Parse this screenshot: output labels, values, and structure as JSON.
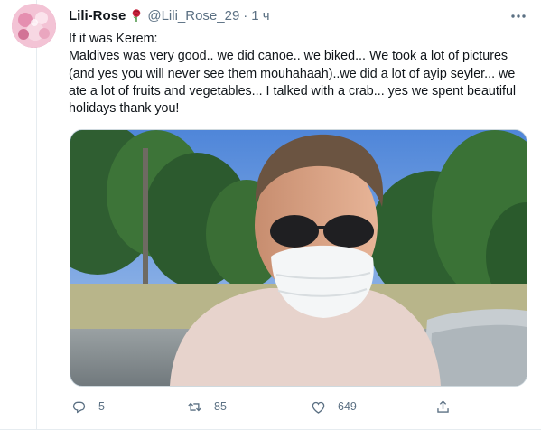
{
  "tweet": {
    "display_name": "Lili-Rose",
    "handle": "@Lili_Rose_29",
    "separator": "·",
    "time": "1 ч",
    "text_lines": [
      "If it was Kerem:",
      "Maldives was very good.. we did canoe.. we biked... We took a lot of pictures (and yes you will never see them mouhahaah)..we did a lot of ayip seyler... we ate a lot of fruits and vegetables... I talked with a crab... yes we spent beautiful holidays thank you!"
    ]
  },
  "actions": {
    "reply_count": "5",
    "retweet_count": "85",
    "like_count": "649"
  },
  "icons": {
    "more": "more-dots-icon",
    "reply": "reply-icon",
    "retweet": "retweet-icon",
    "like": "heart-icon",
    "share": "share-icon",
    "emoji": "rose-emoji"
  },
  "colors": {
    "text": "#0f1419",
    "secondary": "#5b7083",
    "divider": "#e6ecf0"
  }
}
